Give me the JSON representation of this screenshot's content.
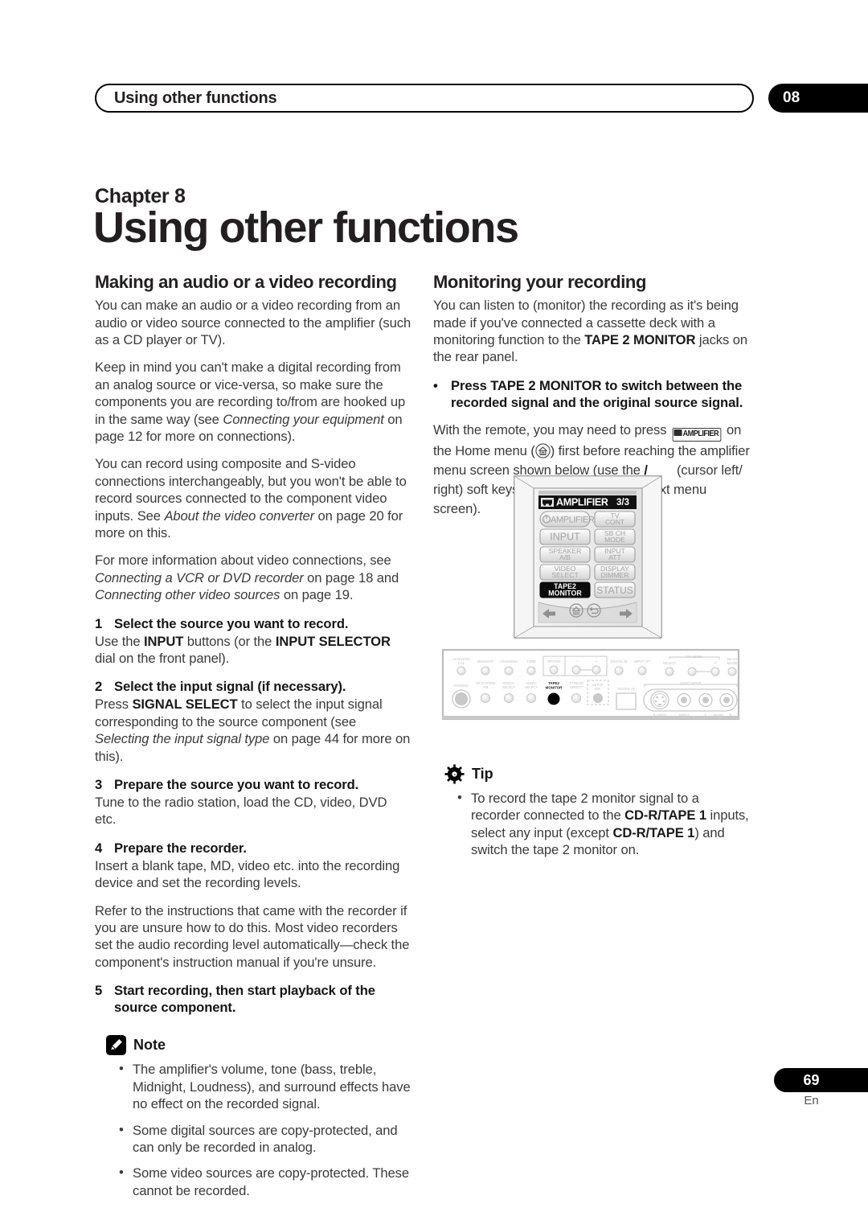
{
  "header": {
    "running_title": "Using other functions",
    "chapter_tab": "08"
  },
  "chapter": {
    "label": "Chapter 8",
    "title": "Using other functions"
  },
  "left_column": {
    "section_title": "Making an audio or a video recording",
    "paragraphs": [
      "You can make an audio or a video recording from an audio or video source connected to the amplifier (such as a CD player or TV).",
      "Keep in mind you can't make a digital recording from an analog source or vice-versa, so make sure the components you are recording to/from are hooked up in the same way (see Connecting your equipment on page 12 for more on connections).",
      "You can record using composite and S-video connections interchangeably, but you won't be able to record sources connected to the component video inputs. See About the video converter on page 20 for more on this.",
      "For more information about video connections, see Connecting a VCR or DVD recorder on page 18 and Connecting other video sources on page 19."
    ],
    "steps": [
      {
        "num": "1",
        "heading": "Select the source you want to record.",
        "body": "Use the INPUT buttons (or the INPUT SELECTOR dial on the front panel)."
      },
      {
        "num": "2",
        "heading": "Select the input signal (if necessary).",
        "body": "Press SIGNAL SELECT to select the input signal corresponding to the source component (see Selecting the input signal type on page 44 for more on this)."
      },
      {
        "num": "3",
        "heading": "Prepare the source you want to record.",
        "body": "Tune to the radio station, load the CD, video, DVD etc."
      },
      {
        "num": "4",
        "heading": "Prepare the recorder.",
        "body": "Insert a blank tape, MD, video etc. into the recording device and set the recording levels."
      },
      {
        "num": "5",
        "heading": "Start recording, then start playback of the source component.",
        "body": ""
      }
    ],
    "step4_extra": "Refer to the instructions that came with the recorder if you are unsure how to do this. Most video recorders set the audio recording level automatically—check the component's instruction manual if you're unsure.",
    "note": {
      "label": "Note",
      "icon": "pencil-note-icon",
      "items": [
        "The amplifier's volume, tone (bass, treble, Midnight, Loudness), and surround effects have no effect on the recorded signal.",
        "Some digital sources are copy-protected, and can only be recorded in analog.",
        "Some video sources are copy-protected. These cannot be recorded."
      ]
    }
  },
  "right_column": {
    "section_title": "Monitoring your recording",
    "intro": "You can listen to (monitor) the recording as it's being made if you've connected a cassette deck with a monitoring function to the TAPE 2 MONITOR jacks on the rear panel.",
    "bullet": "Press TAPE 2 MONITOR to switch between the recorded signal and the original source signal.",
    "remote_note_1": "With the remote, you may need to press",
    "remote_note_button": "AMPLIFIER",
    "remote_note_2": "on the",
    "remote_note_3": "Home menu (",
    "remote_note_4": ") first before reaching the amplifier menu screen shown below (use the /",
    "remote_note_5": "(cursor left/ right) soft keys to go to the previous/next menu screen).",
    "tip": {
      "label": "Tip",
      "icon": "gear-tip-icon",
      "items": [
        "To record the tape 2 monitor signal to a recorder connected to the CD-R/TAPE 1 inputs, select any input (except CD-R/TAPE 1) and switch the tape 2 monitor on."
      ]
    }
  },
  "remote_diagram": {
    "name": "remote-control-amplifier-menu",
    "screen_title": "AMPLIFIER",
    "screen_page": "3/3",
    "screen_icon": "cassette-icon",
    "buttons": [
      {
        "label": "AMPLIFIER",
        "icon": "power-icon",
        "state": "normal",
        "shape": "pill"
      },
      {
        "label": "TV\nCONT",
        "state": "normal"
      },
      {
        "label": "INPUT",
        "state": "normal"
      },
      {
        "label": "SB CH\nMODE",
        "state": "normal"
      },
      {
        "label": "SPEAKER\nA/B",
        "state": "normal"
      },
      {
        "label": "INPUT\nATT",
        "state": "normal"
      },
      {
        "label": "VIDEO\nSELECT",
        "state": "normal"
      },
      {
        "label": "DISPLAY\nDIMMER",
        "state": "normal"
      },
      {
        "label": "TAPE2\nMONITOR",
        "state": "highlighted"
      },
      {
        "label": "STATUS",
        "state": "normal"
      }
    ],
    "nav_icons": [
      "arrow-left-icon",
      "home-icon",
      "return-icon",
      "arrow-right-icon"
    ]
  },
  "panel_diagram": {
    "name": "front-panel-controls",
    "top_row_labels": [
      "ACOUSTIC\nCAL",
      "MIDNIGHT",
      "LOUDNESS",
      "TONE",
      "OPTION",
      "–",
      "+",
      "DIGITAL IN",
      "INPUT ATT",
      "SELECT",
      "–",
      "+",
      "SB CH\nMODE"
    ],
    "ch_level_label": "CH LEVEL",
    "bottom_row_labels": [
      "PHONES",
      "SP SYSTEM\nA/B",
      "SIGNAL\nSELECT",
      "VIDEO\nSELECT",
      "TAPE2\nMONITOR",
      "STREAM\nDIRECT",
      "SETUP\nMIC"
    ],
    "digital_in_label": "DIGITAL IN",
    "video_input_label": "VIDEO INPUT",
    "jack_labels": [
      "S-VIDEO",
      "VIDEO",
      "L",
      "AUDIO",
      "R"
    ],
    "highlighted_control": "TAPE2 MONITOR"
  },
  "footer": {
    "page_number": "69",
    "language": "En"
  },
  "colors": {
    "text": "#3a3a3a",
    "heading": "#151515",
    "accent_black": "#000000",
    "panel_grey": "#c9c9c9"
  }
}
